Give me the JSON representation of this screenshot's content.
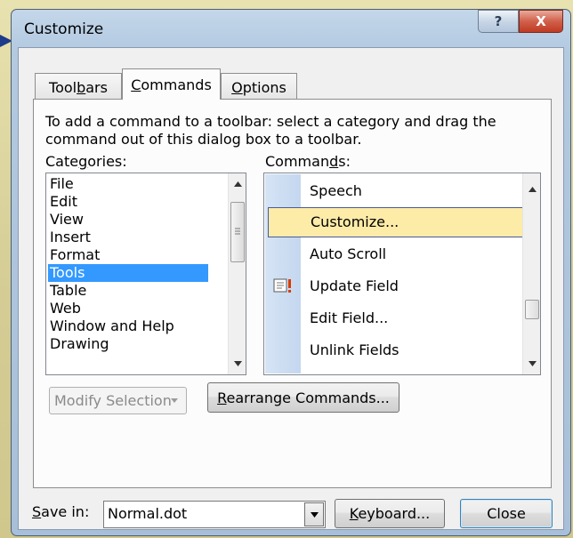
{
  "dialog": {
    "title": "Customize",
    "help_glyph": "?",
    "close_glyph": "X"
  },
  "tabs": [
    {
      "label": "Toolbars",
      "mnemonic_pre": "Tool",
      "mnemonic": "b",
      "mnemonic_post": "ars",
      "active": false
    },
    {
      "label": "Commands",
      "mnemonic_pre": "",
      "mnemonic": "C",
      "mnemonic_post": "ommands",
      "active": true
    },
    {
      "label": "Options",
      "mnemonic_pre": "",
      "mnemonic": "O",
      "mnemonic_post": "ptions",
      "active": false
    }
  ],
  "instruction": "To add a command to a toolbar: select a category and drag the command out of this dialog box to a toolbar.",
  "categories": {
    "label_pre": "Cate",
    "label_mnemonic": "g",
    "label_post": "ories:",
    "items": [
      "File",
      "Edit",
      "View",
      "Insert",
      "Format",
      "Tools",
      "Table",
      "Web",
      "Window and Help",
      "Drawing"
    ],
    "selected": "Tools"
  },
  "commands": {
    "label_pre": "Comman",
    "label_mnemonic": "d",
    "label_post": "s:",
    "items": [
      "Speech",
      "Customize...",
      "Auto Scroll",
      "Update Field",
      "Edit Field...",
      "Unlink Fields"
    ],
    "highlighted": "Customize..."
  },
  "buttons": {
    "modify_selection": "Modify Selection",
    "rearrange_pre": "",
    "rearrange_mnemonic": "R",
    "rearrange_post": "earrange Commands...",
    "keyboard_pre": "",
    "keyboard_mnemonic": "K",
    "keyboard_post": "eyboard...",
    "close": "Close"
  },
  "save_in": {
    "label_pre": "",
    "label_mnemonic": "S",
    "label_post": "ave in:",
    "value": "Normal.dot"
  },
  "icons": {
    "update_field": "update-field-icon",
    "scroll_up": "scroll-up-arrow-icon",
    "scroll_down": "scroll-down-arrow-icon",
    "dropdown": "dropdown-arrow-icon"
  }
}
